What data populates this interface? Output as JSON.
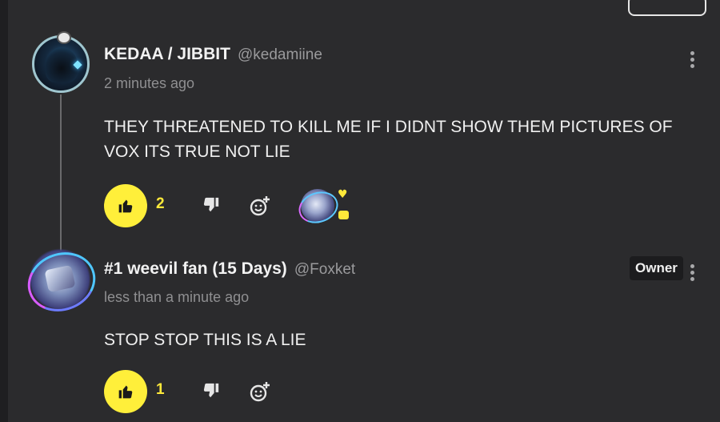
{
  "comments": [
    {
      "display_name": "KEDAA / JIBBIT",
      "handle": "@kedamiine",
      "timestamp": "2 minutes ago",
      "text": "THEY THREATENED TO KILL ME IF I DIDNT SHOW THEM PICTURES OF VOX ITS TRUE NOT LIE",
      "likes": "2",
      "reaction": {
        "avatar": "weevil-avatar",
        "icons": [
          "heart-icon",
          "chat-bubble-icon"
        ]
      }
    },
    {
      "display_name": "#1 weevil fan (15 Days)",
      "handle": "@Foxket",
      "timestamp": "less than a minute ago",
      "text": "STOP STOP THIS IS A LIE",
      "likes": "1",
      "badge": "Owner"
    }
  ],
  "colors": {
    "background": "#2b2b2d",
    "like_button": "#ffef3a",
    "like_count": "#ffe93a",
    "muted_text": "#9a9a9c"
  },
  "icons": {
    "like": "thumbs-up-icon",
    "dislike": "thumbs-down-icon",
    "react": "add-reaction-icon",
    "menu": "more-vertical-icon"
  }
}
